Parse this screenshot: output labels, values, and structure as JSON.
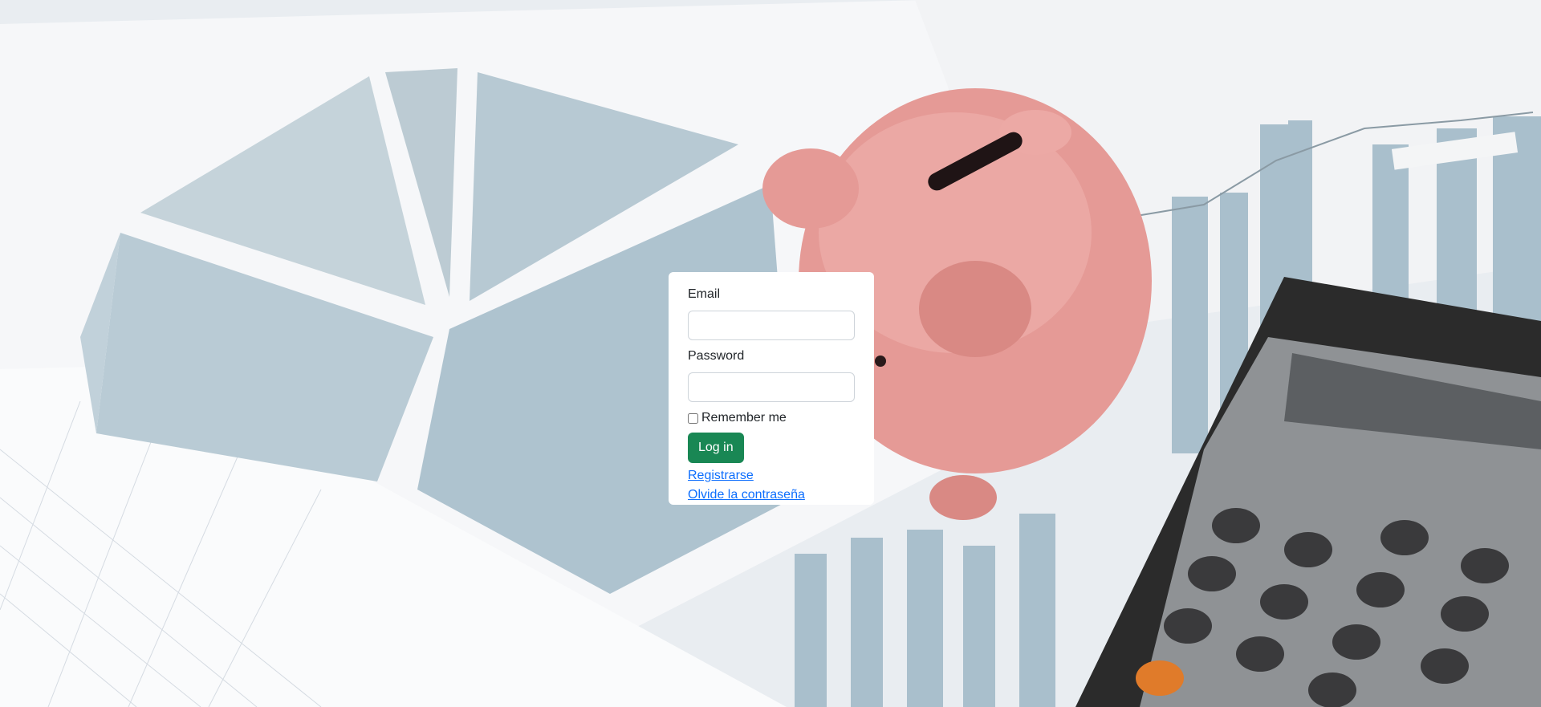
{
  "login": {
    "email_label": "Email",
    "email_value": "",
    "password_label": "Password",
    "password_value": "",
    "remember_label": "Remember me",
    "login_button": "Log in",
    "register_link": "Registrarse",
    "forgot_link": "Olvide la contraseña"
  },
  "colors": {
    "primary_button": "#198754",
    "link": "#0d6efd"
  },
  "background_icons": [
    "pie-chart-icon",
    "piggy-bank-icon",
    "calculator-icon",
    "bar-chart-icon"
  ]
}
